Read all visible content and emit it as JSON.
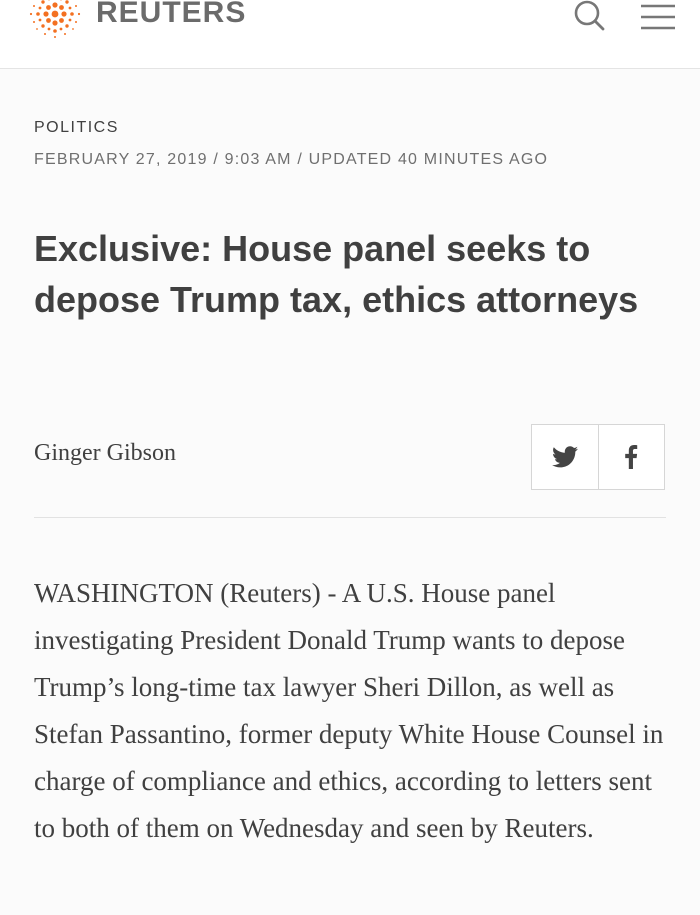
{
  "header": {
    "brand": "REUTERS",
    "logo_icon": "reuters-dot-logo",
    "search_icon": "search-icon",
    "menu_icon": "hamburger-menu-icon",
    "brand_color": "#f37021"
  },
  "article": {
    "section": "POLITICS",
    "dateline": "FEBRUARY 27, 2019 / 9:03 AM / UPDATED 40 MINUTES AGO",
    "headline": "Exclusive: House panel seeks to depose Trump tax, ethics attorneys",
    "author": "Ginger Gibson",
    "share": {
      "twitter_icon": "twitter-icon",
      "facebook_icon": "facebook-icon"
    },
    "body": "WASHINGTON (Reuters) - A U.S. House panel investigating President Donald Trump wants to depose Trump’s long-time tax lawyer Sheri Dillon, as well as Stefan Passantino, former deputy White House Counsel in charge of compliance and ethics, according to letters sent to both of them on Wednesday and seen by Reuters."
  }
}
